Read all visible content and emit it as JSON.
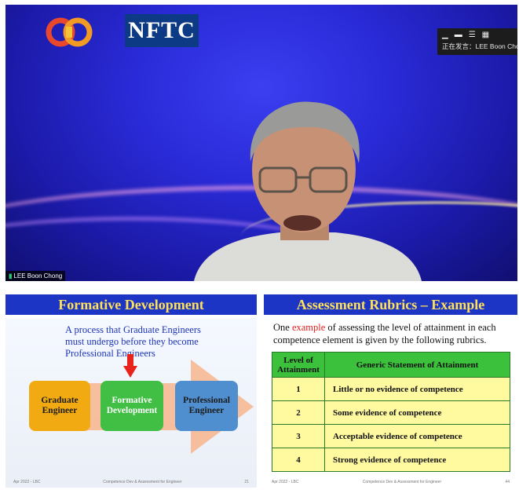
{
  "video": {
    "logo_text": "NFTC",
    "speaking_label": "正在发言：LEE Boon Chong",
    "participant_name": "LEE Boon Chong",
    "signal_icon": "signal-bars-icon",
    "view_icons": [
      "minimize-icon",
      "speaker-view-icon",
      "list-icon",
      "grid-icon"
    ]
  },
  "slide_left": {
    "title": "Formative Development",
    "intro": "A process that Graduate Engineers must undergo before they become Professional Engineers",
    "stages": {
      "graduate": "Graduate Engineer",
      "formative": "Formative Development",
      "professional": "Professional Engineer"
    },
    "footer": {
      "left": "Apr 2022 - LBC",
      "center": "Competence Dev & Assessment for Engineer",
      "right": "21"
    }
  },
  "slide_right": {
    "title": "Assessment Rubrics – Example",
    "intro_pre": "One",
    "intro_highlight": "example",
    "intro_post": "of assessing the level of attainment in each competence element is given by the following rubrics.",
    "table": {
      "header_level": "Level of Attainment",
      "header_statement": "Generic Statement of Attainment",
      "rows": [
        {
          "level": "1",
          "statement": "Little or no evidence of competence"
        },
        {
          "level": "2",
          "statement": "Some evidence of competence"
        },
        {
          "level": "3",
          "statement": "Acceptable evidence of competence"
        },
        {
          "level": "4",
          "statement": "Strong evidence of competence"
        }
      ]
    },
    "footer": {
      "left": "Apr 2022 - LBC",
      "center": "Competence Dev & Assessment for Engineer",
      "right": "44"
    }
  },
  "colors": {
    "slide_title_bg": "#1d35c4",
    "slide_title_text": "#ffe15a",
    "table_header": "#3cc13c",
    "table_cell": "#fff9a0",
    "graduate": "#f2aa13",
    "formative": "#41bf45",
    "professional": "#4f8fd0",
    "highlight": "#e02020"
  }
}
